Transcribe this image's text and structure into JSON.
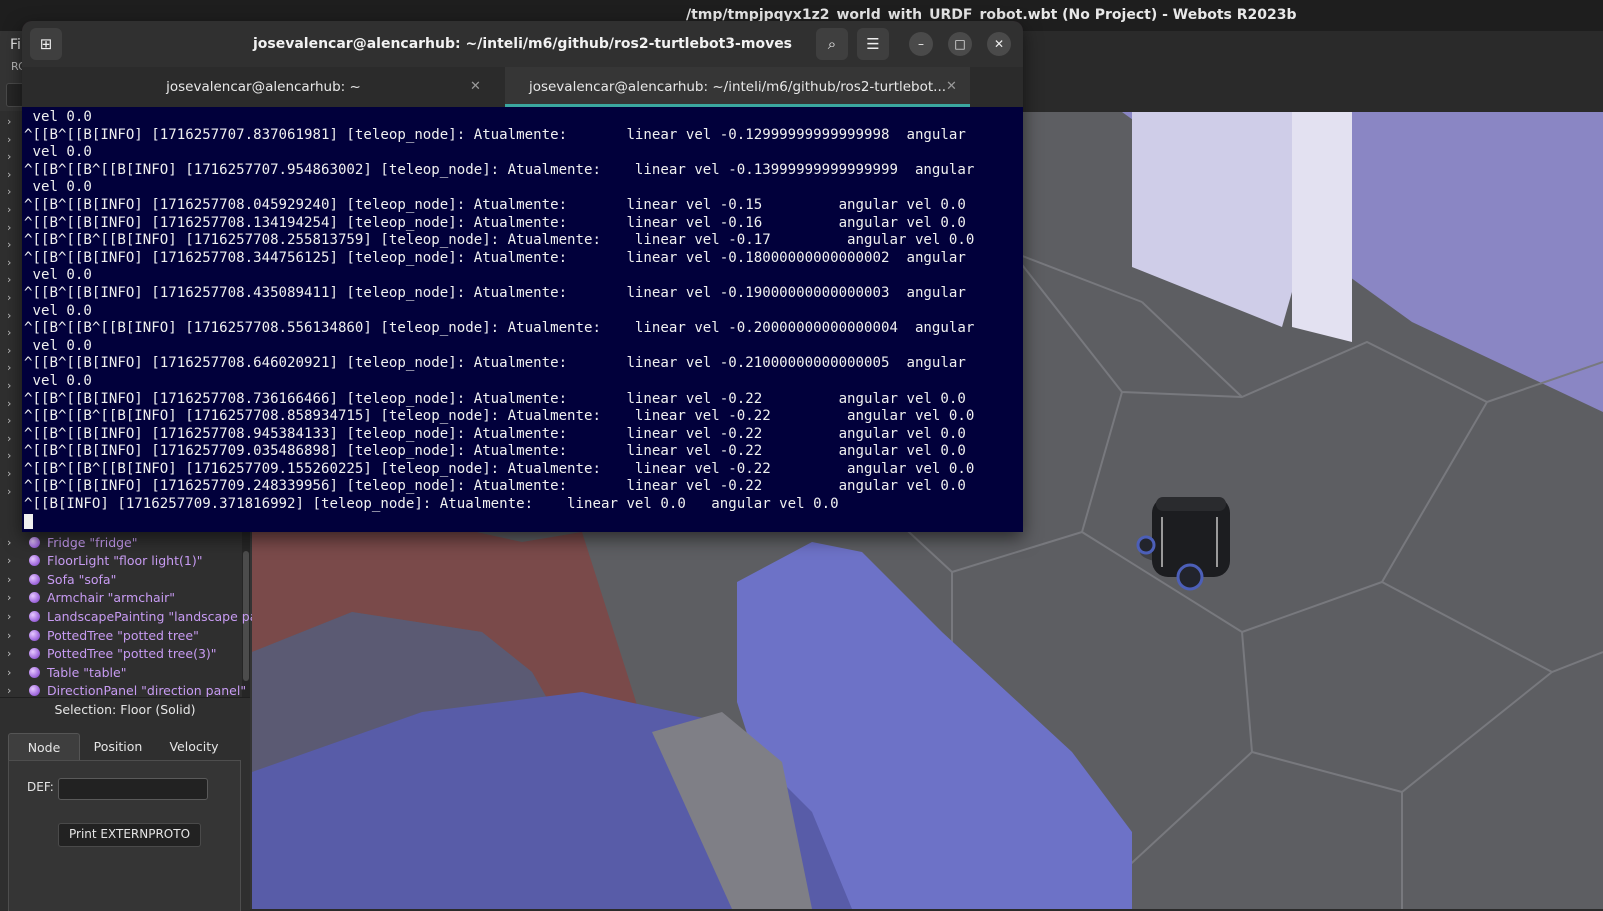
{
  "webots": {
    "title": "/tmp/tmpjpqyx1z2_world_with_URDF_robot.wbt (No Project) - Webots R2023b",
    "menu_partial": "Fi",
    "toolbar_partial": "RC",
    "scene_tree": [
      {
        "label": "Fridge \"fridge\""
      },
      {
        "label": "FloorLight \"floor light(1)\""
      },
      {
        "label": "Sofa \"sofa\""
      },
      {
        "label": "Armchair \"armchair\""
      },
      {
        "label": "LandscapePainting \"landscape pain"
      },
      {
        "label": "PottedTree \"potted tree\""
      },
      {
        "label": "PottedTree \"potted tree(3)\""
      },
      {
        "label": "Table \"table\""
      },
      {
        "label": "DirectionPanel \"direction panel\""
      }
    ],
    "selection_title": "Selection: Floor (Solid)",
    "tabs": [
      "Node",
      "Position",
      "Velocity"
    ],
    "active_tab": "Node",
    "def_label": "DEF:",
    "def_value": "",
    "print_button": "Print EXTERNPROTO"
  },
  "terminal": {
    "title": "josevalencar@alencarhub: ~/inteli/m6/github/ros2-turtlebot3-moves",
    "tabs": [
      {
        "label": "josevalencar@alencarhub: ~",
        "active": false
      },
      {
        "label": "josevalencar@alencarhub: ~/inteli/m6/github/ros2-turtlebot...",
        "active": true
      }
    ],
    "lines": [
      " vel 0.0",
      "^[[B^[[B[INFO] [1716257707.837061981] [teleop_node]: Atualmente:       linear vel -0.12999999999999998  angular",
      " vel 0.0",
      "^[[B^[[B^[[B[INFO] [1716257707.954863002] [teleop_node]: Atualmente:    linear vel -0.13999999999999999  angular",
      " vel 0.0",
      "^[[B^[[B[INFO] [1716257708.045929240] [teleop_node]: Atualmente:       linear vel -0.15         angular vel 0.0",
      "^[[B^[[B[INFO] [1716257708.134194254] [teleop_node]: Atualmente:       linear vel -0.16         angular vel 0.0",
      "^[[B^[[B^[[B[INFO] [1716257708.255813759] [teleop_node]: Atualmente:    linear vel -0.17         angular vel 0.0",
      "^[[B^[[B[INFO] [1716257708.344756125] [teleop_node]: Atualmente:       linear vel -0.18000000000000002  angular",
      " vel 0.0",
      "^[[B^[[B[INFO] [1716257708.435089411] [teleop_node]: Atualmente:       linear vel -0.19000000000000003  angular",
      " vel 0.0",
      "^[[B^[[B^[[B[INFO] [1716257708.556134860] [teleop_node]: Atualmente:    linear vel -0.20000000000000004  angular",
      " vel 0.0",
      "^[[B^[[B[INFO] [1716257708.646020921] [teleop_node]: Atualmente:       linear vel -0.21000000000000005  angular",
      " vel 0.0",
      "^[[B^[[B[INFO] [1716257708.736166466] [teleop_node]: Atualmente:       linear vel -0.22         angular vel 0.0",
      "^[[B^[[B^[[B[INFO] [1716257708.858934715] [teleop_node]: Atualmente:    linear vel -0.22         angular vel 0.0",
      "^[[B^[[B[INFO] [1716257708.945384133] [teleop_node]: Atualmente:       linear vel -0.22         angular vel 0.0",
      "^[[B^[[B[INFO] [1716257709.035486898] [teleop_node]: Atualmente:       linear vel -0.22         angular vel 0.0",
      "^[[B^[[B^[[B[INFO] [1716257709.155260225] [teleop_node]: Atualmente:    linear vel -0.22         angular vel 0.0",
      "^[[B^[[B[INFO] [1716257709.248339956] [teleop_node]: Atualmente:       linear vel -0.22         angular vel 0.0",
      "^[[B[INFO] [1716257709.371816992] [teleop_node]: Atualmente:    linear vel 0.0   angular vel 0.0"
    ],
    "icons": {
      "new_tab": "new-tab-icon",
      "search": "search-icon",
      "menu": "hamburger-menu-icon",
      "minimize": "minimize-icon",
      "maximize": "maximize-icon",
      "close": "close-icon",
      "tab_close": "close-icon",
      "tabs_dropdown": "chevron-down-icon"
    }
  },
  "colors": {
    "terminal_bg": "#01003b",
    "tab_accent": "#3ba7a0",
    "tree_node": "#c79bf2"
  }
}
